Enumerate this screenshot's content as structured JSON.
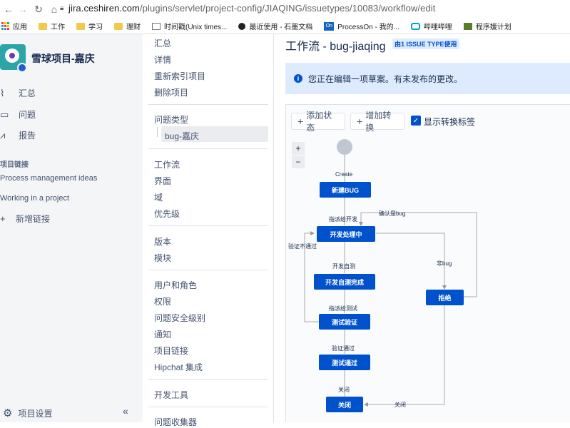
{
  "browser": {
    "url_host": "jira.ceshiren.com",
    "url_path": "/plugins/servlet/project-config/JIAQING/issuetypes/10083/workflow/edit",
    "bookmarks": [
      "应用",
      "工作",
      "学习",
      "理财",
      "时间戳(Unix times...",
      "最近使用 - 石墨文档",
      "ProcessOn - 我的...",
      "哔哩哔哩",
      "程序媛计划"
    ]
  },
  "sidebar": {
    "project_name": "雪球项目-嘉庆",
    "items": [
      {
        "label": "汇总",
        "icon": "pulse-icon"
      },
      {
        "label": "问题",
        "icon": "issues-icon"
      },
      {
        "label": "报告",
        "icon": "chart-icon"
      }
    ],
    "section_title": "项目链接",
    "links": [
      "Process management ideas",
      "Working in a project"
    ],
    "add_link": "新增链接",
    "settings": "项目设置"
  },
  "admin_menu": {
    "group1": [
      "汇总",
      "详情",
      "重新索引项目",
      "删除项目"
    ],
    "group2_title": "问题类型",
    "group2_child": "bug-嘉庆",
    "group3": [
      "工作流",
      "界面",
      "域",
      "优先级"
    ],
    "group4": [
      "版本",
      "模块"
    ],
    "group5": [
      "用户和角色",
      "权限",
      "问题安全级别",
      "通知",
      "项目链接",
      "Hipchat 集成"
    ],
    "group6": [
      "开发工具"
    ],
    "group7": [
      "问题收集器"
    ]
  },
  "main": {
    "title": "工作流 - bug-jiaqing",
    "badge": "由1 ISSUE TYPE使用",
    "info": "您正在编辑一项草案。有未发布的更改。",
    "add_status": "添加状态",
    "add_transition": "增加转换",
    "show_labels": "显示转换标签",
    "zoom_in": "+",
    "zoom_out": "−"
  },
  "workflow": {
    "statuses": {
      "new": "新建BUG",
      "dev": "开发处理中",
      "selftest": "开发自测完成",
      "testverify": "测试验证",
      "testpass": "测试通过",
      "close": "关闭",
      "reject": "拒绝"
    },
    "transitions": {
      "create": "Create",
      "assign_dev": "指派给开发",
      "confirm_bug": "确认是bug",
      "verify_fail": "验证不通过",
      "dev_selftest": "开发自测",
      "not_bug": "非bug",
      "assign_test": "指派给测试",
      "verify_pass": "验证通过",
      "close1": "关闭",
      "close2": "关闭"
    }
  }
}
